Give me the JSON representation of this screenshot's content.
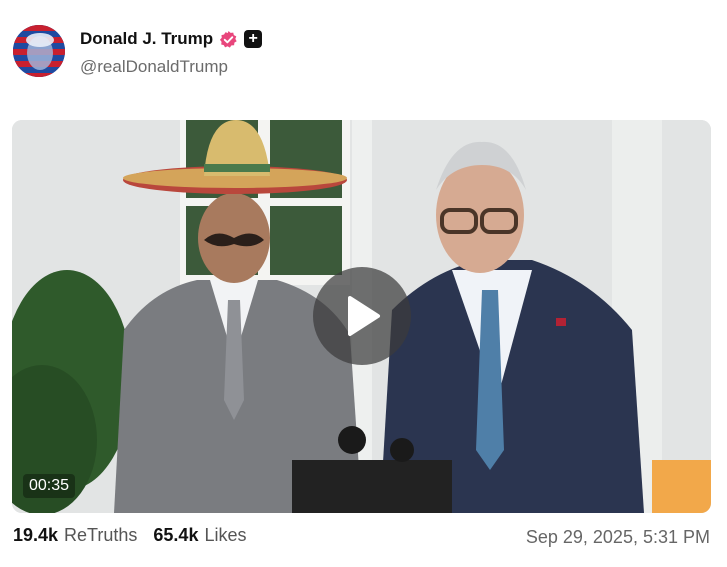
{
  "post": {
    "author_name": "Donald J. Trump",
    "handle": "@realDonaldTrump",
    "verified_icon": "verified-check-icon",
    "badge_icon": "plus-badge-icon",
    "badge_glyph": "+"
  },
  "video": {
    "duration": "00:35",
    "play_icon": "play-icon"
  },
  "stats": {
    "retruths_count": "19.4k",
    "retruths_label": "ReTruths",
    "likes_count": "65.4k",
    "likes_label": "Likes"
  },
  "timestamp": "Sep 29, 2025, 5:31 PM",
  "colors": {
    "verified": "#e8467c",
    "text": "#111111",
    "muted": "#6b6b6b"
  }
}
